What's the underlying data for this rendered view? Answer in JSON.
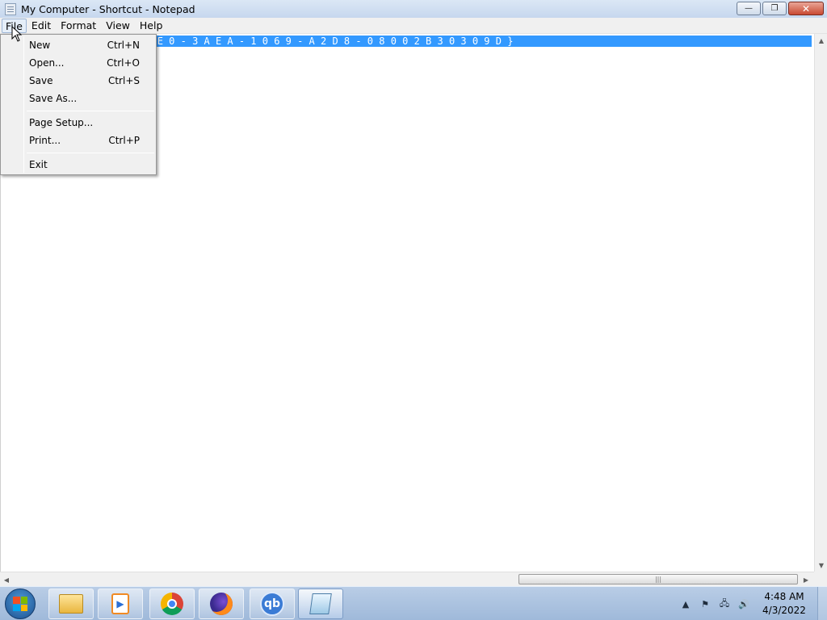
{
  "window": {
    "title": "My Computer - Shortcut - Notepad",
    "controls": {
      "minimize": "—",
      "maximize": "❐",
      "close": "✕"
    }
  },
  "menubar": {
    "items": [
      "File",
      "Edit",
      "Format",
      "View",
      "Help"
    ],
    "active": "File"
  },
  "editor": {
    "visible_line": ")  : : { 2 0 D 0 4 F E 0 - 3 A E A - 1 0 6 9 - A 2 D 8 - 0 8 0 0 2 B 3 0 3 0 9 D }"
  },
  "file_menu": {
    "items": [
      {
        "label": "New",
        "shortcut": "Ctrl+N"
      },
      {
        "label": "Open...",
        "shortcut": "Ctrl+O"
      },
      {
        "label": "Save",
        "shortcut": "Ctrl+S"
      },
      {
        "label": "Save As...",
        "shortcut": ""
      },
      {
        "label": "Page Setup...",
        "shortcut": ""
      },
      {
        "label": "Print...",
        "shortcut": "Ctrl+P"
      },
      {
        "label": "Exit",
        "shortcut": ""
      }
    ]
  },
  "taskbar": {
    "pinned": [
      "folder-icon",
      "media-player-icon",
      "chrome-icon",
      "firefox-icon",
      "qbittorrent-icon",
      "notepad-icon"
    ],
    "qb_text": "qb",
    "clock": {
      "time": "4:48 AM",
      "date": "4/3/2022"
    }
  },
  "colors": {
    "selection": "#3399ff",
    "taskbar": "#b9cde6"
  }
}
